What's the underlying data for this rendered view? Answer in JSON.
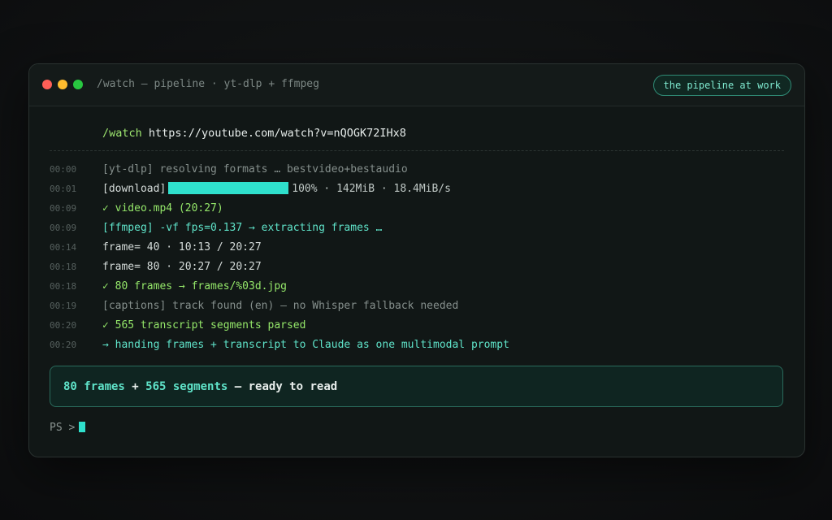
{
  "window": {
    "title": "/watch — pipeline · yt-dlp + ffmpeg",
    "badge": "the pipeline at work",
    "controls": [
      "close",
      "minimize",
      "maximize"
    ]
  },
  "command": {
    "name": "/watch",
    "url": "https://youtube.com/watch?v=nQOGK72IHx8"
  },
  "log": [
    {
      "time": "00:00",
      "text": "[yt-dlp] resolving formats … bestvideo+bestaudio",
      "style": "dim"
    },
    {
      "time": "00:01",
      "label": "[download]",
      "stats": "100% · 142MiB · 18.4MiB/s",
      "progress": 1.0,
      "style": "progress"
    },
    {
      "time": "00:09",
      "text": "✓ video.mp4 (20:27)",
      "style": "green"
    },
    {
      "time": "00:09",
      "text": "[ffmpeg] -vf fps=0.137 → extracting frames …",
      "style": "teal"
    },
    {
      "time": "00:14",
      "text": "frame= 40 · 10:13 / 20:27",
      "style": "plain"
    },
    {
      "time": "00:18",
      "text": "frame= 80 · 20:27 / 20:27",
      "style": "plain"
    },
    {
      "time": "00:18",
      "text": "✓ 80 frames → frames/%03d.jpg",
      "style": "green"
    },
    {
      "time": "00:19",
      "text": "[captions] track found (en) — no Whisper fallback needed",
      "style": "dim"
    },
    {
      "time": "00:20",
      "text": "✓ 565 transcript segments parsed",
      "style": "green"
    },
    {
      "time": "00:20",
      "text": "→ handing frames + transcript to Claude as one multimodal prompt",
      "style": "teal"
    }
  ],
  "summary": {
    "frames": "80 frames",
    "plus": " + ",
    "segments": "565 segments",
    "rest": " — ready to read"
  },
  "prompt": {
    "text": "PS >"
  },
  "colors": {
    "accent": "#2fe0cc",
    "success": "#95e86a",
    "close": "#ff5f57",
    "minimize": "#febc2e",
    "maximize": "#28c840"
  }
}
